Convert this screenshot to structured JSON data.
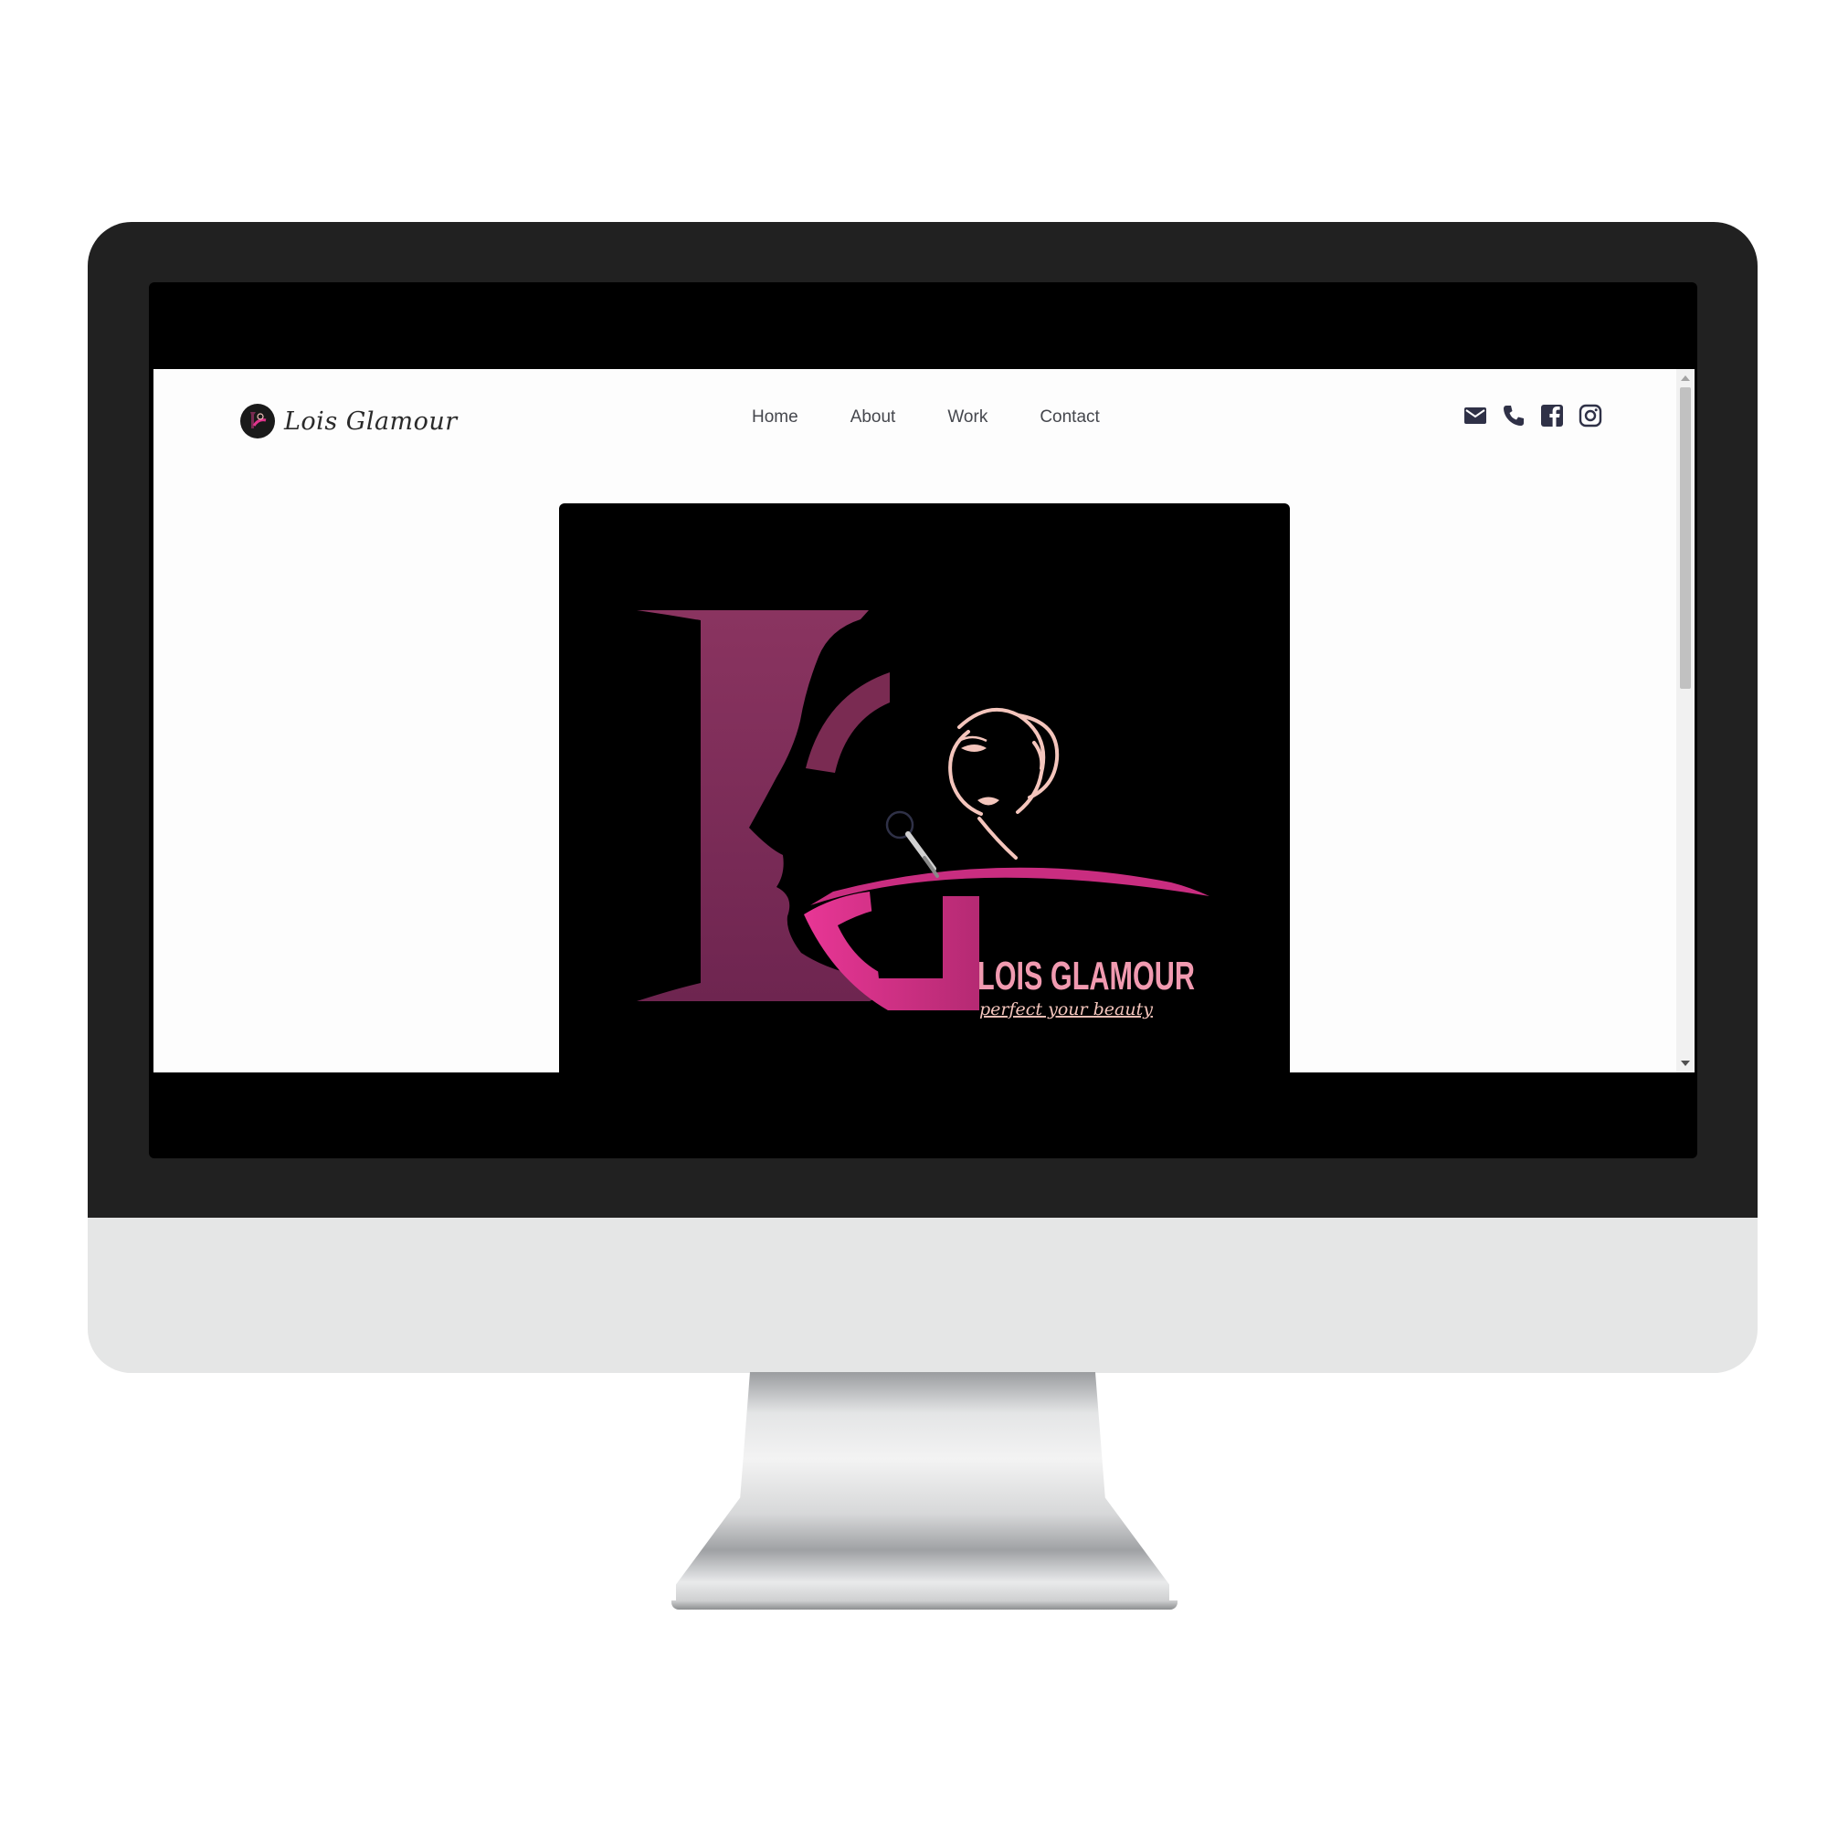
{
  "site": {
    "brand_name": "Lois Glamour"
  },
  "nav": {
    "items": [
      {
        "label": "Home"
      },
      {
        "label": "About"
      },
      {
        "label": "Work"
      },
      {
        "label": "Contact"
      }
    ]
  },
  "social": {
    "icons": [
      "mail-icon",
      "phone-icon",
      "facebook-icon",
      "instagram-icon"
    ]
  },
  "hero": {
    "logo_title": "LOIS GLAMOUR",
    "logo_tagline": "perfect your beauty"
  },
  "colors": {
    "brand_magenta": "#e0338c",
    "brand_plum": "#7a2b52",
    "brand_blush": "#f4c5bc",
    "nav_icon": "#2f3147"
  }
}
